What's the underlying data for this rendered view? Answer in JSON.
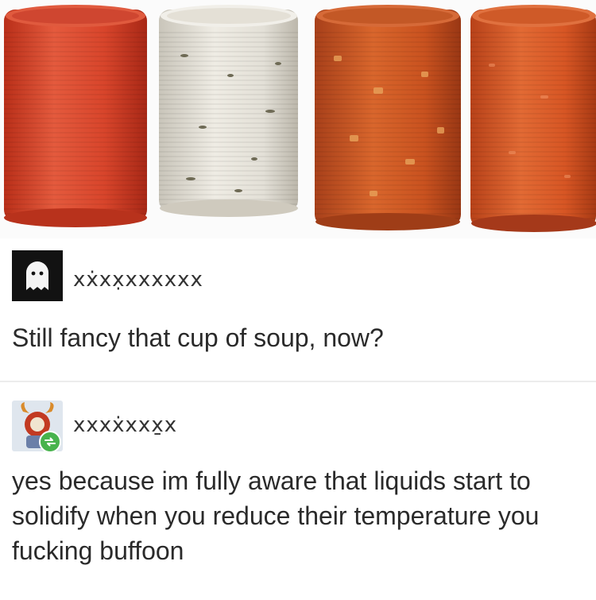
{
  "image": {
    "description_label": "soup-cylinders-photo"
  },
  "posts": [
    {
      "username": "xẋxx̣xxxxxx",
      "text": "Still fancy that cup of soup, now?",
      "avatar": "ghost-icon"
    },
    {
      "username": "xxxẋxxx̱x",
      "text": "yes because im fully aware that liquids start to solidify when you reduce their temperature you fucking buffoon",
      "avatar": "horned-character-icon",
      "badge": "reblog-icon"
    }
  ],
  "colors": {
    "soup_red": "#d8452b",
    "soup_white": "#e6e3da",
    "soup_chunky": "#c9521f",
    "soup_orange": "#d75624",
    "reblog_green": "#48b34d"
  }
}
